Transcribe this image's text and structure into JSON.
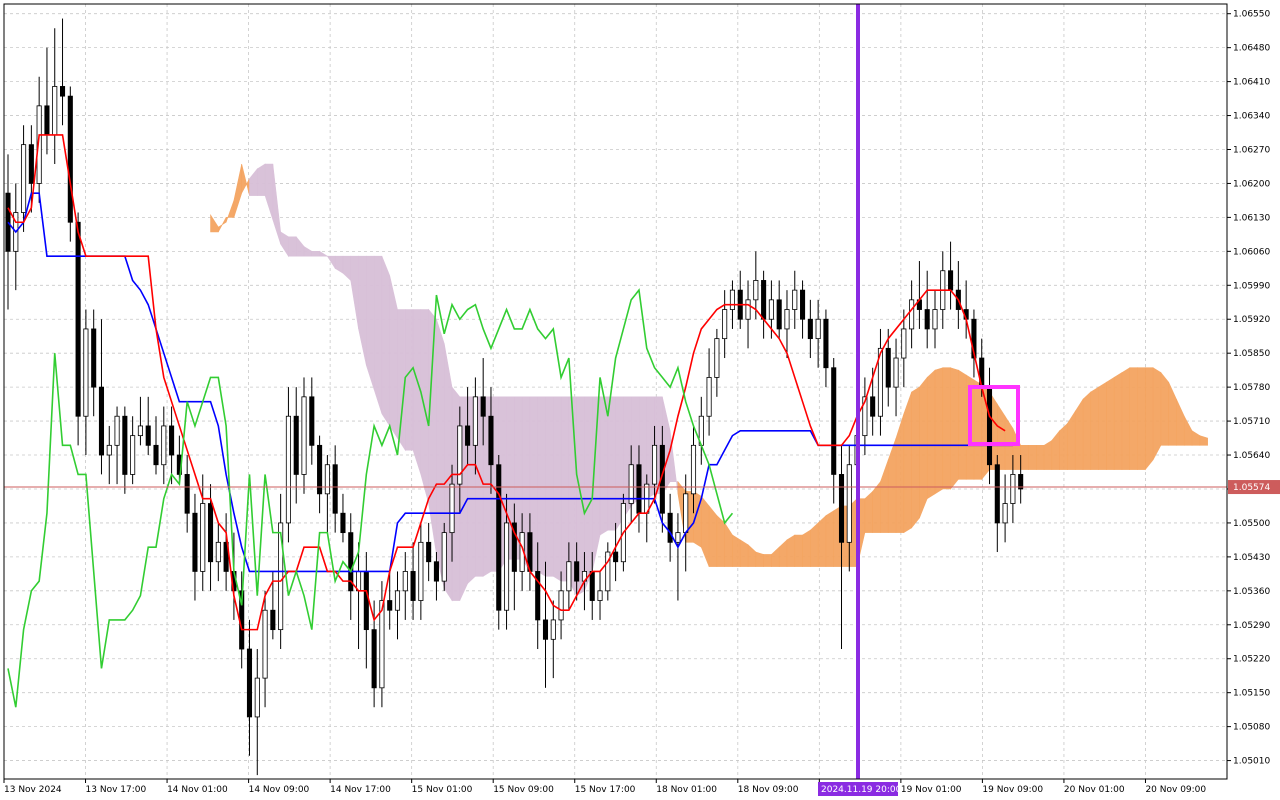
{
  "chart_data": {
    "type": "candlestick",
    "instrument_note": "",
    "current_price": 1.05574,
    "current_price_label": "1.05574",
    "vertical_marker_label": "2024.11.19 20:00",
    "y_ticks": [
      "1.06550",
      "1.06480",
      "1.06410",
      "1.06340",
      "1.06270",
      "1.06200",
      "1.06130",
      "1.06060",
      "1.05990",
      "1.05920",
      "1.05850",
      "1.05780",
      "1.05710",
      "1.05640",
      "1.05570",
      "1.05500",
      "1.05430",
      "1.05360",
      "1.05290",
      "1.05220",
      "1.05150",
      "1.05080",
      "1.05010"
    ],
    "ylim": [
      1.04972,
      1.0657
    ],
    "x_labels": [
      "13 Nov 2024",
      "13 Nov 17:00",
      "14 Nov 01:00",
      "14 Nov 09:00",
      "14 Nov 17:00",
      "15 Nov 01:00",
      "15 Nov 09:00",
      "15 Nov 17:00",
      "18 Nov 01:00",
      "18 Nov 09:00",
      "18 Nov 17:00",
      "19 Nov 01:00",
      "19 Nov 09:00",
      "20 Nov 01:00",
      "20 Nov 09:00"
    ],
    "candles": [
      [
        1.0618,
        1.0626,
        1.0594,
        1.0606
      ],
      [
        1.0606,
        1.062,
        1.0598,
        1.0614
      ],
      [
        1.0614,
        1.0632,
        1.061,
        1.0628
      ],
      [
        1.0628,
        1.0632,
        1.0614,
        1.062
      ],
      [
        1.062,
        1.0642,
        1.0616,
        1.0636
      ],
      [
        1.0636,
        1.0648,
        1.0626,
        1.063
      ],
      [
        1.063,
        1.0652,
        1.0624,
        1.064
      ],
      [
        1.064,
        1.0654,
        1.0632,
        1.0638
      ],
      [
        1.0638,
        1.064,
        1.0608,
        1.0612
      ],
      [
        1.0612,
        1.0614,
        1.0566,
        1.0572
      ],
      [
        1.0572,
        1.0594,
        1.0564,
        1.059
      ],
      [
        1.059,
        1.0594,
        1.0572,
        1.0578
      ],
      [
        1.0578,
        1.0592,
        1.056,
        1.0564
      ],
      [
        1.0564,
        1.057,
        1.0558,
        1.0566
      ],
      [
        1.0566,
        1.0574,
        1.0558,
        1.0572
      ],
      [
        1.0572,
        1.0574,
        1.0556,
        1.056
      ],
      [
        1.056,
        1.0572,
        1.0558,
        1.0568
      ],
      [
        1.0568,
        1.0576,
        1.0566,
        1.057
      ],
      [
        1.057,
        1.0576,
        1.0564,
        1.0566
      ],
      [
        1.0566,
        1.0572,
        1.056,
        1.0562
      ],
      [
        1.0562,
        1.0574,
        1.0558,
        1.057
      ],
      [
        1.057,
        1.0574,
        1.0558,
        1.0564
      ],
      [
        1.0564,
        1.0568,
        1.0558,
        1.056
      ],
      [
        1.056,
        1.0564,
        1.0548,
        1.0552
      ],
      [
        1.0552,
        1.0556,
        1.0534,
        1.054
      ],
      [
        1.054,
        1.056,
        1.0536,
        1.0554
      ],
      [
        1.0554,
        1.0558,
        1.0536,
        1.0542
      ],
      [
        1.0542,
        1.055,
        1.0538,
        1.0546
      ],
      [
        1.0546,
        1.0552,
        1.0536,
        1.054
      ],
      [
        1.054,
        1.0548,
        1.053,
        1.0536
      ],
      [
        1.0536,
        1.054,
        1.052,
        1.0524
      ],
      [
        1.0524,
        1.053,
        1.0502,
        1.051
      ],
      [
        1.051,
        1.0524,
        1.0498,
        1.0518
      ],
      [
        1.0518,
        1.0536,
        1.0512,
        1.0532
      ],
      [
        1.0532,
        1.054,
        1.0526,
        1.0528
      ],
      [
        1.0528,
        1.0556,
        1.0524,
        1.055
      ],
      [
        1.055,
        1.0578,
        1.0546,
        1.0572
      ],
      [
        1.0572,
        1.0578,
        1.0554,
        1.056
      ],
      [
        1.056,
        1.058,
        1.0556,
        1.0576
      ],
      [
        1.0576,
        1.058,
        1.0562,
        1.0566
      ],
      [
        1.0566,
        1.0568,
        1.0552,
        1.0556
      ],
      [
        1.0556,
        1.0564,
        1.0548,
        1.0562
      ],
      [
        1.0562,
        1.0566,
        1.0548,
        1.0552
      ],
      [
        1.0552,
        1.0556,
        1.0546,
        1.0548
      ],
      [
        1.0548,
        1.0552,
        1.053,
        1.0536
      ],
      [
        1.0536,
        1.0546,
        1.0524,
        1.054
      ],
      [
        1.054,
        1.0544,
        1.052,
        1.0528
      ],
      [
        1.0528,
        1.0534,
        1.0512,
        1.0516
      ],
      [
        1.0516,
        1.0538,
        1.0512,
        1.0534
      ],
      [
        1.0534,
        1.054,
        1.0528,
        1.0532
      ],
      [
        1.0532,
        1.054,
        1.0526,
        1.0536
      ],
      [
        1.0536,
        1.0544,
        1.053,
        1.054
      ],
      [
        1.054,
        1.0546,
        1.053,
        1.0534
      ],
      [
        1.0534,
        1.055,
        1.053,
        1.0546
      ],
      [
        1.0546,
        1.055,
        1.0538,
        1.0542
      ],
      [
        1.0542,
        1.0544,
        1.0534,
        1.0538
      ],
      [
        1.0538,
        1.055,
        1.0536,
        1.0548
      ],
      [
        1.0548,
        1.0562,
        1.0542,
        1.0558
      ],
      [
        1.0558,
        1.0574,
        1.0552,
        1.057
      ],
      [
        1.057,
        1.0578,
        1.0562,
        1.0566
      ],
      [
        1.0566,
        1.058,
        1.056,
        1.0576
      ],
      [
        1.0576,
        1.0584,
        1.0566,
        1.0572
      ],
      [
        1.0572,
        1.0578,
        1.0556,
        1.0562
      ],
      [
        1.0562,
        1.0564,
        1.0528,
        1.0532
      ],
      [
        1.0532,
        1.0556,
        1.0528,
        1.055
      ],
      [
        1.055,
        1.0554,
        1.0532,
        1.054
      ],
      [
        1.054,
        1.0552,
        1.0536,
        1.0548
      ],
      [
        1.0548,
        1.0552,
        1.0536,
        1.054
      ],
      [
        1.054,
        1.0546,
        1.0524,
        1.053
      ],
      [
        1.053,
        1.0542,
        1.0516,
        1.0526
      ],
      [
        1.0526,
        1.0534,
        1.0518,
        1.053
      ],
      [
        1.053,
        1.054,
        1.0526,
        1.0536
      ],
      [
        1.0536,
        1.0546,
        1.0532,
        1.0542
      ],
      [
        1.0542,
        1.0546,
        1.0534,
        1.0538
      ],
      [
        1.0538,
        1.0544,
        1.0532,
        1.054
      ],
      [
        1.054,
        1.0544,
        1.053,
        1.0534
      ],
      [
        1.0534,
        1.054,
        1.053,
        1.0536
      ],
      [
        1.0536,
        1.0546,
        1.0534,
        1.0544
      ],
      [
        1.0544,
        1.055,
        1.0538,
        1.0542
      ],
      [
        1.0542,
        1.0556,
        1.054,
        1.0554
      ],
      [
        1.0554,
        1.0566,
        1.055,
        1.0562
      ],
      [
        1.0562,
        1.0566,
        1.0548,
        1.0552
      ],
      [
        1.0552,
        1.056,
        1.0546,
        1.0558
      ],
      [
        1.0558,
        1.057,
        1.0554,
        1.0566
      ],
      [
        1.0566,
        1.057,
        1.0548,
        1.0552
      ],
      [
        1.0552,
        1.0556,
        1.0542,
        1.0546
      ],
      [
        1.0546,
        1.0552,
        1.0534,
        1.0548
      ],
      [
        1.0548,
        1.056,
        1.054,
        1.0556
      ],
      [
        1.0556,
        1.057,
        1.0552,
        1.0566
      ],
      [
        1.0566,
        1.0576,
        1.0562,
        1.0572
      ],
      [
        1.0572,
        1.0586,
        1.0568,
        1.058
      ],
      [
        1.058,
        1.059,
        1.0576,
        1.0588
      ],
      [
        1.0588,
        1.0598,
        1.0584,
        1.0594
      ],
      [
        1.0594,
        1.06,
        1.059,
        1.0598
      ],
      [
        1.0598,
        1.0602,
        1.059,
        1.0592
      ],
      [
        1.0592,
        1.06,
        1.0586,
        1.0596
      ],
      [
        1.0596,
        1.0606,
        1.0592,
        1.06
      ],
      [
        1.06,
        1.0602,
        1.0588,
        1.0592
      ],
      [
        1.0592,
        1.06,
        1.0588,
        1.0596
      ],
      [
        1.0596,
        1.06,
        1.0588,
        1.059
      ],
      [
        1.059,
        1.0598,
        1.0584,
        1.0594
      ],
      [
        1.0594,
        1.0602,
        1.059,
        1.0598
      ],
      [
        1.0598,
        1.06,
        1.0588,
        1.0592
      ],
      [
        1.0592,
        1.0596,
        1.0584,
        1.0588
      ],
      [
        1.0588,
        1.0596,
        1.0582,
        1.0592
      ],
      [
        1.0592,
        1.0594,
        1.0578,
        1.0582
      ],
      [
        1.0582,
        1.0584,
        1.0554,
        1.056
      ],
      [
        1.056,
        1.0566,
        1.0524,
        1.0546
      ],
      [
        1.0546,
        1.0566,
        1.054,
        1.0562
      ],
      [
        1.0562,
        1.0572,
        1.0556,
        1.0568
      ],
      [
        1.0568,
        1.058,
        1.0564,
        1.0576
      ],
      [
        1.0576,
        1.0582,
        1.0568,
        1.0572
      ],
      [
        1.0572,
        1.059,
        1.0568,
        1.0586
      ],
      [
        1.0586,
        1.059,
        1.0574,
        1.0578
      ],
      [
        1.0578,
        1.0588,
        1.0572,
        1.0584
      ],
      [
        1.0584,
        1.0594,
        1.0578,
        1.059
      ],
      [
        1.059,
        1.06,
        1.0586,
        1.0596
      ],
      [
        1.0596,
        1.0604,
        1.059,
        1.0594
      ],
      [
        1.0594,
        1.0602,
        1.0586,
        1.059
      ],
      [
        1.059,
        1.0598,
        1.0586,
        1.0594
      ],
      [
        1.0594,
        1.0606,
        1.059,
        1.0602
      ],
      [
        1.0602,
        1.0608,
        1.0594,
        1.0598
      ],
      [
        1.0598,
        1.0604,
        1.059,
        1.0594
      ],
      [
        1.0594,
        1.06,
        1.0588,
        1.0592
      ],
      [
        1.0592,
        1.0594,
        1.058,
        1.0584
      ],
      [
        1.0584,
        1.0588,
        1.0576,
        1.0578
      ],
      [
        1.0578,
        1.0582,
        1.0558,
        1.0562
      ],
      [
        1.0562,
        1.0564,
        1.0544,
        1.055
      ],
      [
        1.055,
        1.056,
        1.0546,
        1.0554
      ],
      [
        1.0554,
        1.0564,
        1.055,
        1.056
      ],
      [
        1.056,
        1.0564,
        1.0554,
        1.0557
      ]
    ],
    "tenkan": [
      1.0615,
      1.0612,
      1.0612,
      1.0615,
      1.063,
      1.063,
      1.063,
      1.063,
      1.062,
      1.061,
      1.0605,
      1.0605,
      1.0605,
      1.0605,
      1.0605,
      1.0605,
      1.0605,
      1.0605,
      1.0605,
      1.059,
      1.058,
      1.0575,
      1.057,
      1.0565,
      1.056,
      1.0555,
      1.0555,
      1.055,
      1.0548,
      1.0535,
      1.0528,
      1.0528,
      1.0528,
      1.0535,
      1.0538,
      1.0538,
      1.054,
      1.054,
      1.0545,
      1.0545,
      1.0545,
      1.054,
      1.054,
      1.0538,
      1.0538,
      1.0536,
      1.0536,
      1.053,
      1.0532,
      1.054,
      1.0545,
      1.0545,
      1.0545,
      1.055,
      1.0555,
      1.0558,
      1.0558,
      1.056,
      1.056,
      1.0562,
      1.0562,
      1.0558,
      1.0558,
      1.0556,
      1.0552,
      1.0548,
      1.0545,
      1.054,
      1.0538,
      1.0536,
      1.0533,
      1.0532,
      1.0532,
      1.0535,
      1.0538,
      1.054,
      1.054,
      1.0542,
      1.0545,
      1.0548,
      1.055,
      1.0552,
      1.0552,
      1.0555,
      1.056,
      1.0565,
      1.0572,
      1.0578,
      1.0585,
      1.059,
      1.0592,
      1.0594,
      1.0595,
      1.0595,
      1.0595,
      1.0595,
      1.0594,
      1.0592,
      1.059,
      1.0588,
      1.0585,
      1.058,
      1.0575,
      1.057,
      1.0566,
      1.0566,
      1.0566,
      1.0566,
      1.0568,
      1.0572,
      1.0575,
      1.058,
      1.0585,
      1.0588,
      1.059,
      1.0592,
      1.0594,
      1.0596,
      1.0598,
      1.0598,
      1.0598,
      1.0598,
      1.0596,
      1.0592,
      1.0585,
      1.0578,
      1.0572,
      1.057,
      1.0569
    ],
    "kijun": [
      1.0612,
      1.061,
      1.0612,
      1.0618,
      1.0618,
      1.0605,
      1.0605,
      1.0605,
      1.0605,
      1.0605,
      1.0605,
      1.0605,
      1.0605,
      1.0605,
      1.0605,
      1.0605,
      1.06,
      1.0598,
      1.0595,
      1.059,
      1.0585,
      1.058,
      1.0575,
      1.0575,
      1.0575,
      1.0575,
      1.0575,
      1.057,
      1.056,
      1.0552,
      1.0545,
      1.054,
      1.054,
      1.054,
      1.054,
      1.054,
      1.054,
      1.054,
      1.054,
      1.054,
      1.054,
      1.054,
      1.054,
      1.054,
      1.054,
      1.054,
      1.054,
      1.054,
      1.054,
      1.054,
      1.055,
      1.0552,
      1.0552,
      1.0552,
      1.0552,
      1.0552,
      1.0552,
      1.0552,
      1.0552,
      1.0555,
      1.0555,
      1.0555,
      1.0555,
      1.0555,
      1.0555,
      1.0555,
      1.0555,
      1.0555,
      1.0555,
      1.0555,
      1.0555,
      1.0555,
      1.0555,
      1.0555,
      1.0555,
      1.0555,
      1.0555,
      1.0555,
      1.0555,
      1.0555,
      1.0555,
      1.0555,
      1.0555,
      1.0555,
      1.055,
      1.0548,
      1.0545,
      1.0548,
      1.055,
      1.0555,
      1.0562,
      1.0562,
      1.0565,
      1.0568,
      1.0569,
      1.0569,
      1.0569,
      1.0569,
      1.0569,
      1.0569,
      1.0569,
      1.0569,
      1.0569,
      1.0569,
      1.0566,
      1.0566,
      1.0566,
      1.0566,
      1.0566,
      1.0566,
      1.0566,
      1.0566,
      1.0566,
      1.0566,
      1.0566,
      1.0566,
      1.0566,
      1.0566,
      1.0566,
      1.0566,
      1.0566,
      1.0566,
      1.0566,
      1.0566,
      1.0566,
      1.0566,
      1.0566,
      1.0566,
      1.0566,
      1.0566
    ],
    "chikou": [
      1.052,
      1.0512,
      1.0528,
      1.0536,
      1.0538,
      1.0552,
      1.0585,
      1.0566,
      1.0566,
      1.056,
      1.056,
      1.054,
      1.052,
      1.053,
      1.053,
      1.053,
      1.0532,
      1.0535,
      1.0545,
      1.0545,
      1.0555,
      1.056,
      1.0558,
      1.0575,
      1.057,
      1.0575,
      1.058,
      1.058,
      1.057,
      1.054,
      1.0533,
      1.056,
      1.0535,
      1.056,
      1.0548,
      1.0548,
      1.0535,
      1.054,
      1.0535,
      1.0528,
      1.0548,
      1.0548,
      1.0538,
      1.0542,
      1.054,
      1.0544,
      1.056,
      1.057,
      1.0566,
      1.057,
      1.0564,
      1.058,
      1.0582,
      1.0577,
      1.057,
      1.0597,
      1.0589,
      1.0595,
      1.0592,
      1.0594,
      1.0595,
      1.059,
      1.0586,
      1.059,
      1.0594,
      1.059,
      1.059,
      1.0594,
      1.059,
      1.0588,
      1.059,
      1.058,
      1.0584,
      1.056,
      1.0552,
      1.0555,
      1.058,
      1.0572,
      1.0584,
      1.059,
      1.0596,
      1.0598,
      1.0586,
      1.0582,
      1.058,
      1.0578,
      1.0582,
      1.0575,
      1.057,
      1.0566,
      1.0562,
      1.0556,
      1.055,
      1.0552
    ]
  }
}
